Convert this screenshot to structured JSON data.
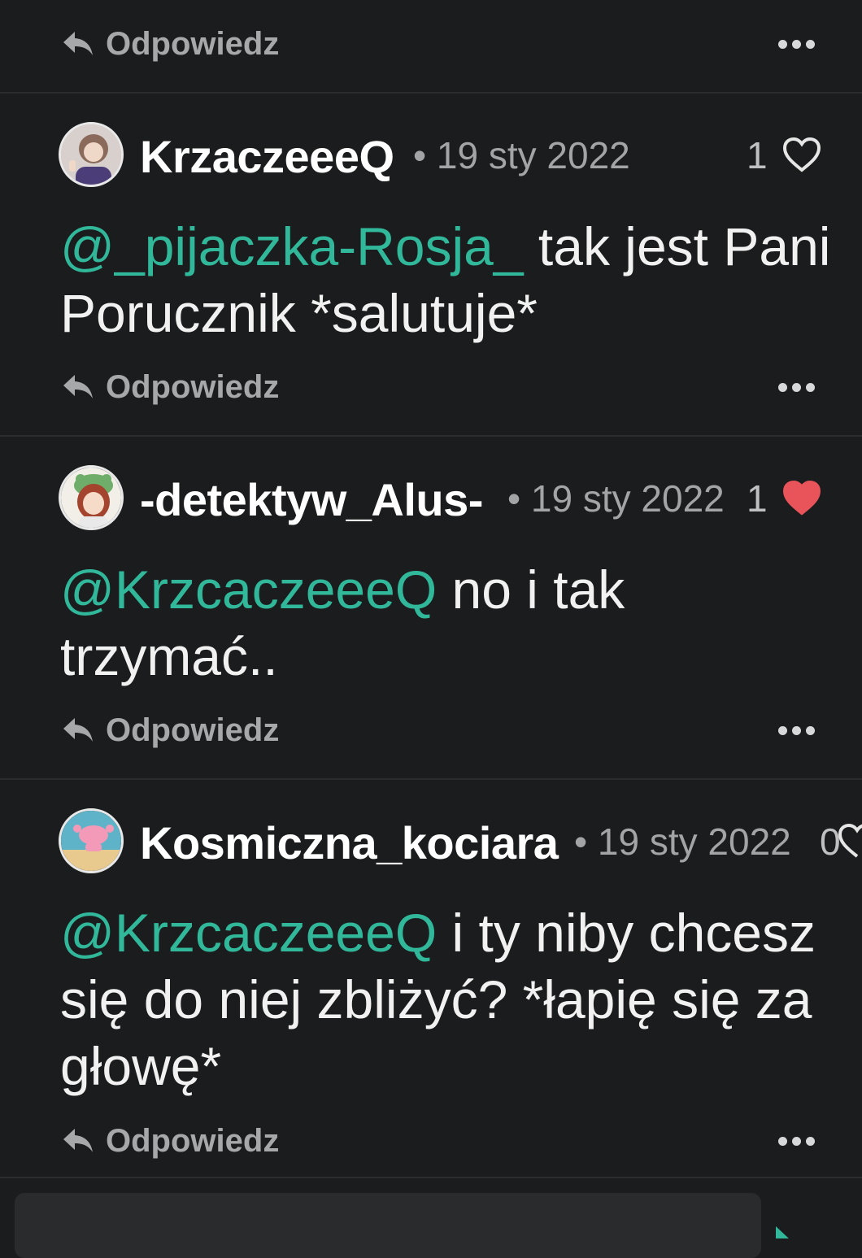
{
  "reply_label": "Odpowiedz",
  "comments": [
    {
      "username": "KrzaczeeeQ",
      "date": "19 sty 2022",
      "likes": "1",
      "liked": false,
      "mention": "@_pijaczka-Rosja_",
      "text": " tak jest Pani Porucznik *salutuje*"
    },
    {
      "username": "-detektyw_Alus-",
      "date": "19 sty 2022",
      "likes": "1",
      "liked": true,
      "mention": "@KrzcaczeeeQ",
      "text": " no i tak trzymać.."
    },
    {
      "username": "Kosmiczna_kociara",
      "date": "19 sty 2022",
      "likes": "0",
      "liked": false,
      "mention": "@KrzcaczeeeQ",
      "text": " i ty niby chcesz się do niej zbliżyć? *łapię się za głowę*"
    }
  ],
  "colors": {
    "background": "#1b1c1d",
    "mention": "#31b89a",
    "liked_heart": "#e8545a",
    "meta": "#a3a4a6"
  }
}
